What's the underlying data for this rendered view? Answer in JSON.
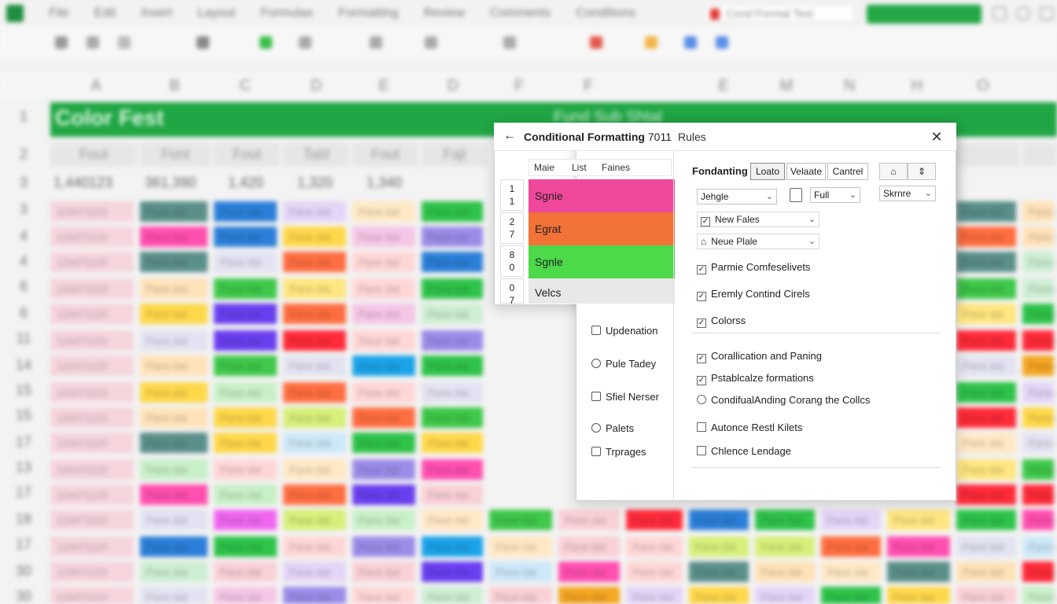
{
  "background": {
    "menu": [
      "File",
      "Edit",
      "Insert",
      "Layout",
      "Formulas",
      "Formatting",
      "Review",
      "Comments",
      "Conditions"
    ],
    "document_box": "Cond Format Test",
    "column_headers": [
      "A",
      "B",
      "C",
      "D",
      "E",
      "D",
      "F",
      "F",
      "E",
      "M",
      "N",
      "H",
      "O"
    ],
    "row_headers": [
      "1",
      "2",
      "3",
      "3",
      "4",
      "4",
      "6",
      "6",
      "11",
      "14",
      "15",
      "15",
      "17",
      "13",
      "17",
      "18",
      "17",
      "30",
      "30"
    ],
    "title_band_text": "Color Fest",
    "title_band_subtext": "Fund Sub Shtal",
    "header_row": [
      "Fout",
      "Font",
      "Fout",
      "Tald",
      "Fout",
      "Fajl"
    ],
    "first_values": [
      "1,440123",
      "361,390",
      "1,420",
      "1,320",
      "1,340"
    ],
    "row_label": "124471123",
    "cell_text": "Pane dat"
  },
  "dialog": {
    "title_bold": "Conditional Formatting",
    "title_num": "7011",
    "breadcrumb": "Rules",
    "rule_list_tabs": [
      "Maie",
      "List",
      "Faines"
    ],
    "rules": [
      {
        "num": "1\n1",
        "label": "Sgnie",
        "color": "#f0489a"
      },
      {
        "num": "2\n7",
        "label": "Egrat",
        "color": "#f27238"
      },
      {
        "num": "8\n0",
        "label": "Sgnle",
        "color": "#4cd94a"
      },
      {
        "num": "0\n7",
        "label": "Velcs",
        "color": "#e8e8e8"
      }
    ],
    "side_items": [
      "Updenation",
      "Pule Tadey",
      "Sfiel Nerser",
      "Palets",
      "Trprages"
    ],
    "panel": {
      "label": "Fondanting",
      "segments": [
        "Loato",
        "Velaate",
        "Cantrel"
      ],
      "icon_buttons": [
        "⌂",
        "⇕"
      ],
      "dropdown1": "Jehgle",
      "dropdown2": "Full",
      "dropdown3": "Skrnre",
      "select_rows": [
        {
          "label": "New Fales",
          "checked": true
        },
        {
          "label": "Neue Plale",
          "checked": false
        }
      ],
      "checks_group1": [
        {
          "label": "Parmie Comfeselivets",
          "checked": true
        },
        {
          "label": "Eremly Contind Cirels",
          "checked": true
        },
        {
          "label": "Colorss",
          "checked": true
        }
      ],
      "checks_group2": [
        {
          "label": "Corallication and Paning",
          "type": "check",
          "checked": true
        },
        {
          "label": "Pstablcalze formations",
          "type": "check",
          "checked": true
        },
        {
          "label": "CondifualAnding Corang the Collcs",
          "type": "radio",
          "checked": false
        },
        {
          "label": "Autonce Restl Kilets",
          "type": "check",
          "checked": false
        },
        {
          "label": "Chlence Lendage",
          "type": "check",
          "checked": false
        }
      ]
    }
  },
  "colors": {
    "brand_green": "#20a644",
    "pink": "#f0489a",
    "orange": "#f27238",
    "green": "#4cd94a"
  }
}
